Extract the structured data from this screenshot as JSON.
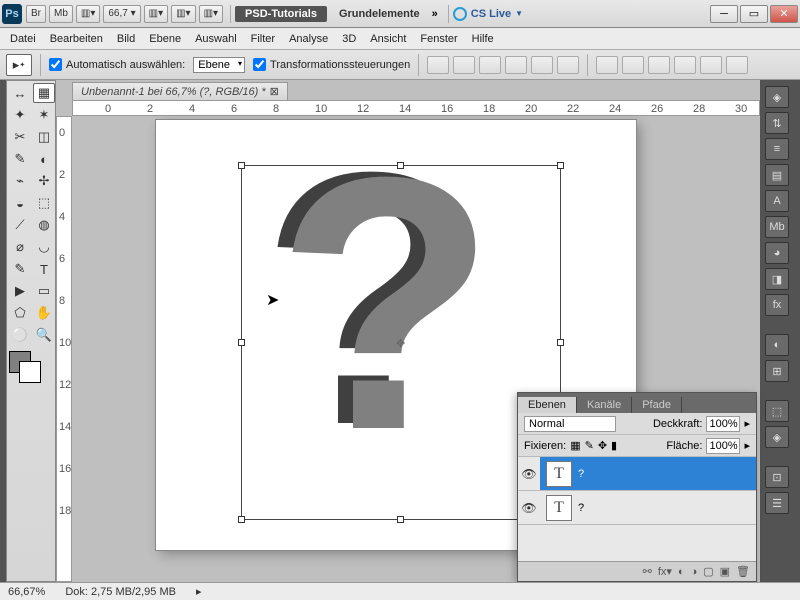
{
  "titlebar": {
    "ps_label": "Ps",
    "buttons": [
      "Br",
      "Mb",
      "▥▾",
      "66,7 ▾",
      "▥▾",
      "▥▾",
      "▥▾"
    ],
    "workspace_active": "PSD-Tutorials",
    "workspace_inactive": "Grundelemente",
    "cs_live": "CS Live"
  },
  "menu": [
    "Datei",
    "Bearbeiten",
    "Bild",
    "Ebene",
    "Auswahl",
    "Filter",
    "Analyse",
    "3D",
    "Ansicht",
    "Fenster",
    "Hilfe"
  ],
  "options": {
    "auto_select_label": "Automatisch auswählen:",
    "auto_select_value": "Ebene",
    "transform_label": "Transformationssteuerungen"
  },
  "doc_tab": "Unbenannt-1 bei 66,7% (?, RGB/16) *",
  "ruler_marks": [
    "0",
    "2",
    "4",
    "6",
    "8",
    "10",
    "12",
    "14",
    "16",
    "18",
    "20",
    "22",
    "24",
    "26",
    "28",
    "30"
  ],
  "ruler_v_marks": [
    "0",
    "2",
    "4",
    "6",
    "8",
    "10",
    "12",
    "14",
    "16",
    "18"
  ],
  "canvas": {
    "glyph": "?"
  },
  "layers_panel": {
    "tabs": [
      "Ebenen",
      "Kanäle",
      "Pfade"
    ],
    "blend_mode": "Normal",
    "opacity_label": "Deckkraft:",
    "opacity_value": "100%",
    "lock_label": "Fixieren:",
    "fill_label": "Fläche:",
    "fill_value": "100%",
    "layers": [
      {
        "thumb": "T",
        "name": "?",
        "selected": true
      },
      {
        "thumb": "T",
        "name": "?",
        "selected": false
      }
    ]
  },
  "status": {
    "zoom": "66,67%",
    "doc_size": "Dok: 2,75 MB/2,95 MB"
  },
  "tools": [
    "↔",
    "▦",
    "✦",
    "✶",
    "✂",
    "◫",
    "✎",
    "◐",
    "⌁",
    "✢",
    "◒",
    "⬚",
    "⟋",
    "◍",
    "⌀",
    "◡",
    "✎",
    "T",
    "▶",
    "▭",
    "⬠",
    "✋",
    "⚪",
    "🔍"
  ],
  "right_icons": [
    "◈",
    "⇅",
    "≡",
    "▤",
    "A",
    "Mb",
    "◕",
    "◨",
    "fx",
    "",
    "◐",
    "⊞",
    "",
    "⬚",
    "◈",
    "",
    "⊡",
    "☰"
  ]
}
